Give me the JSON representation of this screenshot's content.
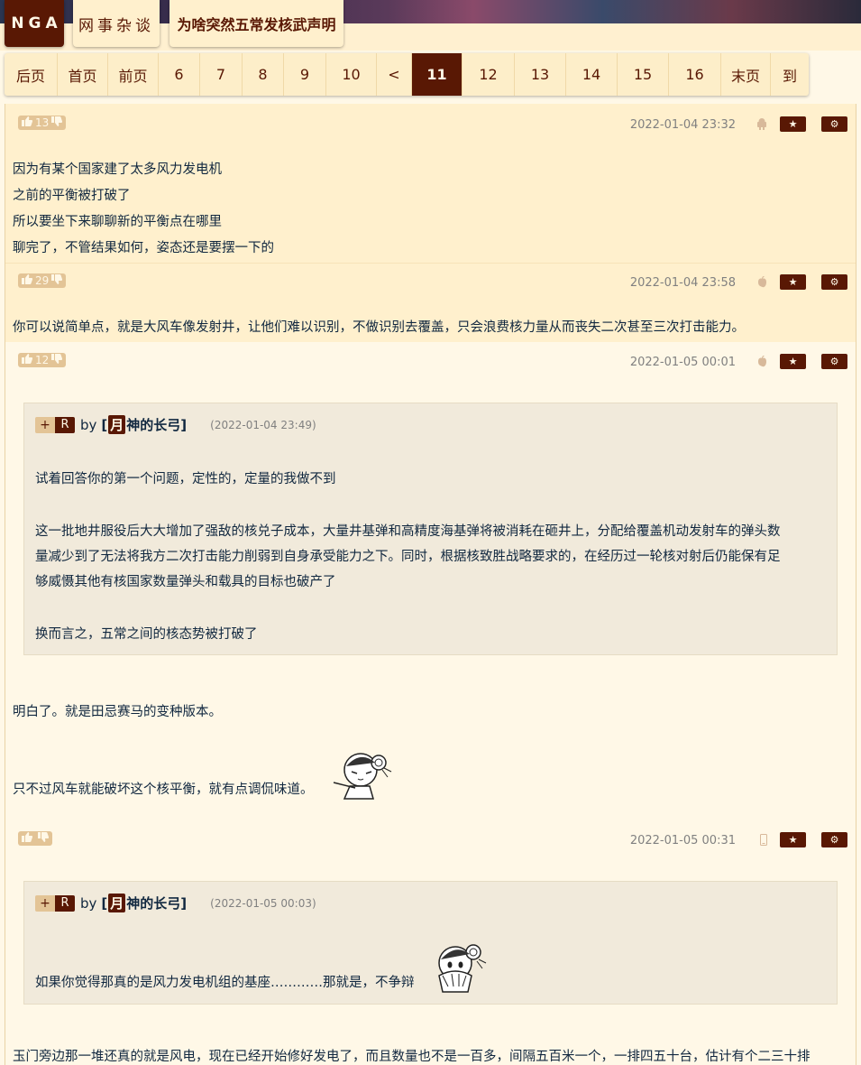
{
  "breadcrumb": {
    "site": "NGA",
    "board": "网事杂谈",
    "topic": "为啥突然五常发核武声明"
  },
  "pager": {
    "items": [
      "后页",
      "首页",
      "前页",
      "6",
      "7",
      "8",
      "9",
      "10",
      "<",
      "11",
      "12",
      "13",
      "14",
      "15",
      "16",
      "末页",
      "到"
    ],
    "current": "11"
  },
  "posts": [
    {
      "votes": "13",
      "time": "2022-01-04 23:32",
      "device_icon": "android-icon",
      "lines": [
        "因为有某个国家建了太多风力发电机",
        "之前的平衡被打破了",
        "所以要坐下来聊聊新的平衡点在哪里",
        "聊完了，不管结果如何，姿态还是要摆一下的"
      ]
    },
    {
      "votes": "29",
      "time": "2022-01-04 23:58",
      "device_icon": "apple-icon",
      "lines": [
        "你可以说简单点，就是大风车像发射井，让他们难以识别，不做识别去覆盖，只会浪费核力量从而丧失二次甚至三次打击能力。"
      ]
    },
    {
      "votes": "12",
      "time": "2022-01-05 00:01",
      "device_icon": "apple-icon",
      "quote": {
        "plus": "+",
        "r": "R",
        "by": "by",
        "user_prefix": "[",
        "user_moon": "月",
        "user_rest": "神的长弓]",
        "date": "(2022-01-04 23:49)",
        "lines": [
          "试着回答你的第一个问题，定性的，定量的我做不到",
          "这一批地井服役后大大增加了强敌的核兑子成本，大量井基弹和高精度海基弹将被消耗在砸井上，分配给覆盖机动发射车的弹头数",
          "量减少到了无法将我方二次打击能力削弱到自身承受能力之下。同时，根据核致胜战略要求的，在经历过一轮核对射后仍能保有足",
          "够威慑其他有核国家数量弹头和载具的目标也破产了",
          "换而言之，五常之间的核态势被打破了"
        ]
      },
      "lines": [
        "明白了。就是田忌赛马的变种版本。",
        "只不过风车就能破坏这个核平衡，就有点调侃味道。"
      ]
    },
    {
      "votes": "",
      "time": "2022-01-05 00:31",
      "device_icon": "phone-icon",
      "quote": {
        "plus": "+",
        "r": "R",
        "by": "by",
        "user_prefix": "[",
        "user_moon": "月",
        "user_rest": "神的长弓]",
        "date": "(2022-01-05 00:03)",
        "lines": [
          "如果你觉得那真的是风力发电机组的基座…………那就是，不争辩"
        ]
      },
      "lines": [
        "玉门旁边那一堆还真的就是风电，现在已经开始修好发电了，而且数量也不是一百多，间隔五百米一个，一排四五十台，估计有个二三十排"
      ]
    }
  ],
  "buttons": {
    "star": "★",
    "gear": "⚙"
  },
  "colors": {
    "accent": "#591804",
    "post_bg_alt": "#fff0cd",
    "post_bg": "#fff8e7",
    "quote_bg": "#f1eadb",
    "vote_bg": "#e3c496",
    "text": "#10273f"
  }
}
